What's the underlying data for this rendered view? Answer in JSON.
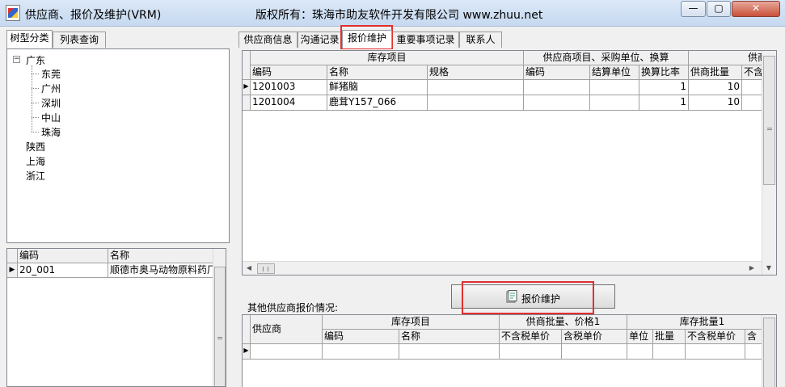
{
  "window": {
    "title": "供应商、报价及维护(VRM)",
    "copyright": "版权所有：珠海市助友软件开发有限公司 www.zhuu.net",
    "min_label": "—",
    "max_label": "▢",
    "close_label": "✕"
  },
  "left_tabs": [
    "树型分类",
    "列表查询"
  ],
  "tree": [
    {
      "label": "广东",
      "children": [
        "东莞",
        "广州",
        "深圳",
        "中山",
        "珠海"
      ]
    },
    {
      "label": "陕西"
    },
    {
      "label": "上海"
    },
    {
      "label": "浙江"
    }
  ],
  "supplier_list": {
    "headers": [
      "编码",
      "名称"
    ],
    "rows": [
      [
        "20_001",
        "顺德市奥马动物原料药厂"
      ]
    ]
  },
  "right_tabs": [
    "供应商信息",
    "沟通记录",
    "报价维护",
    "重要事项记录",
    "联系人"
  ],
  "quote_grid": {
    "group_headers": [
      "库存项目",
      "供应商项目、采购单位、换算",
      "供商"
    ],
    "headers": [
      "编码",
      "名称",
      "规格",
      "编码",
      "结算单位",
      "换算比率",
      "供商批量",
      "不含"
    ],
    "rows": [
      [
        "1201003",
        "鲜猪脑",
        "",
        "",
        "",
        "1",
        "10",
        ""
      ],
      [
        "1201004",
        "鹿茸Y157_066",
        "",
        "",
        "",
        "1",
        "10",
        ""
      ]
    ]
  },
  "maintain_button": "报价维护",
  "other_label": "其他供应商报价情况:",
  "other_grid": {
    "supplier_header": "供应商",
    "group_headers": [
      "库存项目",
      "供商批量、价格1",
      "库存批量1"
    ],
    "headers": [
      "编码",
      "名称",
      "不含税单价",
      "含税单价",
      "单位",
      "批量",
      "不含税单价",
      "含"
    ]
  },
  "colors": {
    "highlight": "#e03030"
  }
}
